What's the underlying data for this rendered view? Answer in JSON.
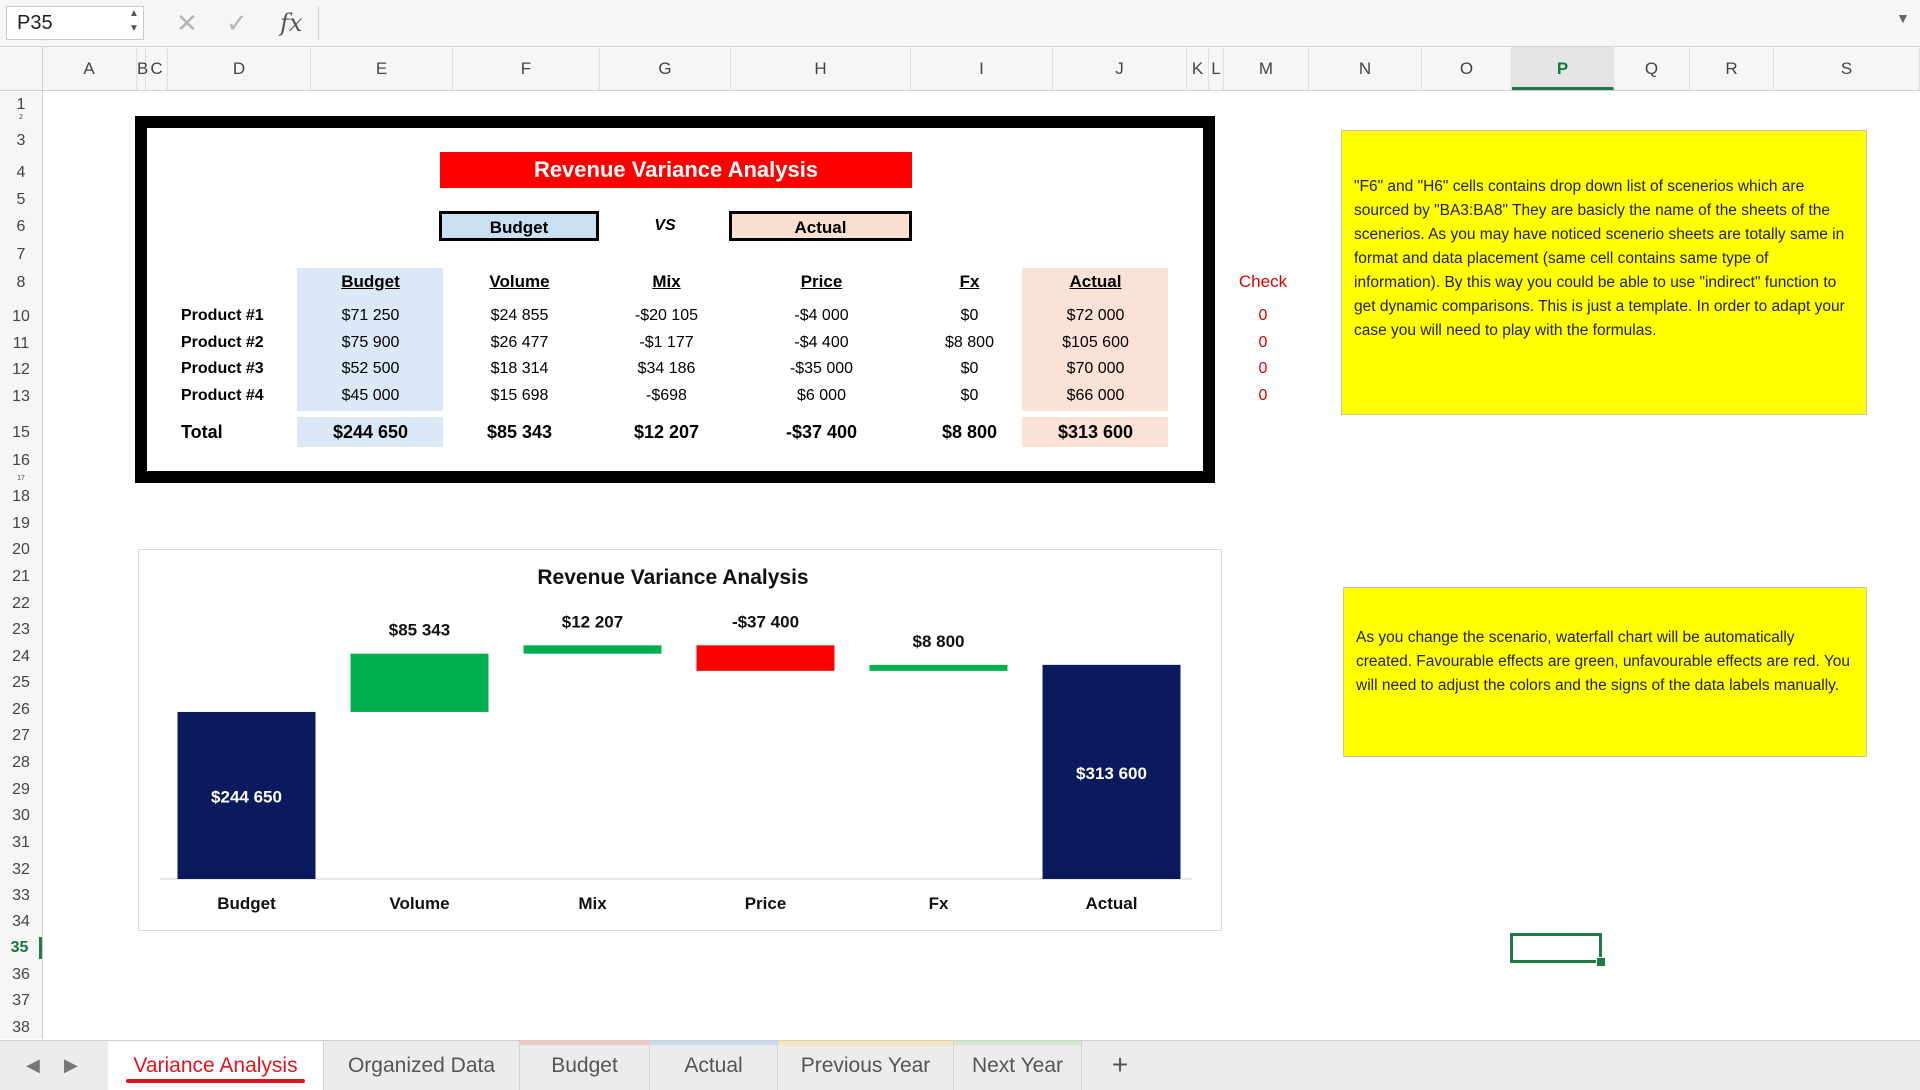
{
  "formula_bar": {
    "name_box": "P35",
    "cancel_icon": "✕",
    "confirm_icon": "✓",
    "fx_label": "fx",
    "formula": ""
  },
  "columns": [
    "A",
    "B",
    "C",
    "D",
    "E",
    "F",
    "G",
    "H",
    "I",
    "J",
    "K",
    "L",
    "M",
    "N",
    "O",
    "P",
    "Q",
    "R",
    "S"
  ],
  "selected_column": "P",
  "rows": [
    "1",
    "2",
    "3",
    "4",
    "5",
    "6",
    "7",
    "8",
    "10",
    "11",
    "12",
    "13",
    "15",
    "16",
    "17",
    "18",
    "19",
    "20",
    "21",
    "22",
    "23",
    "24",
    "25",
    "26",
    "27",
    "28",
    "29",
    "30",
    "31",
    "32",
    "33",
    "34",
    "35",
    "36",
    "37",
    "38"
  ],
  "selected_row": "35",
  "table": {
    "banner": "Revenue Variance Analysis",
    "scenario_left": "Budget",
    "vs": "VS",
    "scenario_right": "Actual",
    "headers": [
      "Budget",
      "Volume",
      "Mix",
      "Price",
      "Fx",
      "Actual"
    ],
    "row_labels": [
      "Product #1",
      "Product #2",
      "Product #3",
      "Product #4"
    ],
    "cells": [
      [
        "$71 250",
        "$24 855",
        "-$20 105",
        "-$4 000",
        "$0",
        "$72 000"
      ],
      [
        "$75 900",
        "$26 477",
        "-$1 177",
        "-$4 400",
        "$8 800",
        "$105 600"
      ],
      [
        "$52 500",
        "$18 314",
        "$34 186",
        "-$35 000",
        "$0",
        "$70 000"
      ],
      [
        "$45 000",
        "$15 698",
        "-$698",
        "$6 000",
        "$0",
        "$66 000"
      ]
    ],
    "total_label": "Total",
    "totals": [
      "$244 650",
      "$85 343",
      "$12 207",
      "-$37 400",
      "$8 800",
      "$313 600"
    ],
    "check_header": "Check",
    "checks": [
      "0",
      "0",
      "0",
      "0"
    ]
  },
  "notes": {
    "note1": "\"F6\" and \"H6\" cells contains drop down list of scenerios which are sourced by \"BA3:BA8\" They are basicly the name of the sheets of the scenerios. As you may have noticed scenerio sheets are totally same in format and data placement (same cell contains same type of information). By this way you could be able to use \"indirect\" function to get dynamic comparisons. This is just a template. In order to adapt your case you will need to play with the formulas.",
    "note2": "As you change the scenario, waterfall chart will be automatically created. Favourable effects are green, unfavourable effects are red. You will need to adjust the colors and the signs of the data labels manually."
  },
  "chart_data": {
    "type": "bar",
    "subtype": "waterfall",
    "title": "Revenue Variance Analysis",
    "categories": [
      "Budget",
      "Volume",
      "Mix",
      "Price",
      "Fx",
      "Actual"
    ],
    "values": [
      244650,
      85343,
      12207,
      -37400,
      8800,
      313600
    ],
    "labels": [
      "$244 650",
      "$85 343",
      "$12 207",
      "-$37 400",
      "$8 800",
      "$313 600"
    ],
    "kinds": [
      "total",
      "delta",
      "delta",
      "delta",
      "delta",
      "total"
    ],
    "ylim": [
      0,
      350000
    ],
    "grid": false,
    "legend": "none",
    "colors": {
      "total": "#0b1a5c",
      "favourable": "#00b050",
      "unfavourable": "#ff0000"
    }
  },
  "sheet_tabs": [
    {
      "label": "Variance Analysis",
      "active": true,
      "color": ""
    },
    {
      "label": "Organized Data",
      "active": false,
      "color": ""
    },
    {
      "label": "Budget",
      "active": false,
      "color": "#f4c7c3"
    },
    {
      "label": "Actual",
      "active": false,
      "color": "#c6dcf2"
    },
    {
      "label": "Previous Year",
      "active": false,
      "color": "#fbe5b5"
    },
    {
      "label": "Next Year",
      "active": false,
      "color": "#cfe8cf"
    }
  ],
  "add_sheet_label": "+"
}
